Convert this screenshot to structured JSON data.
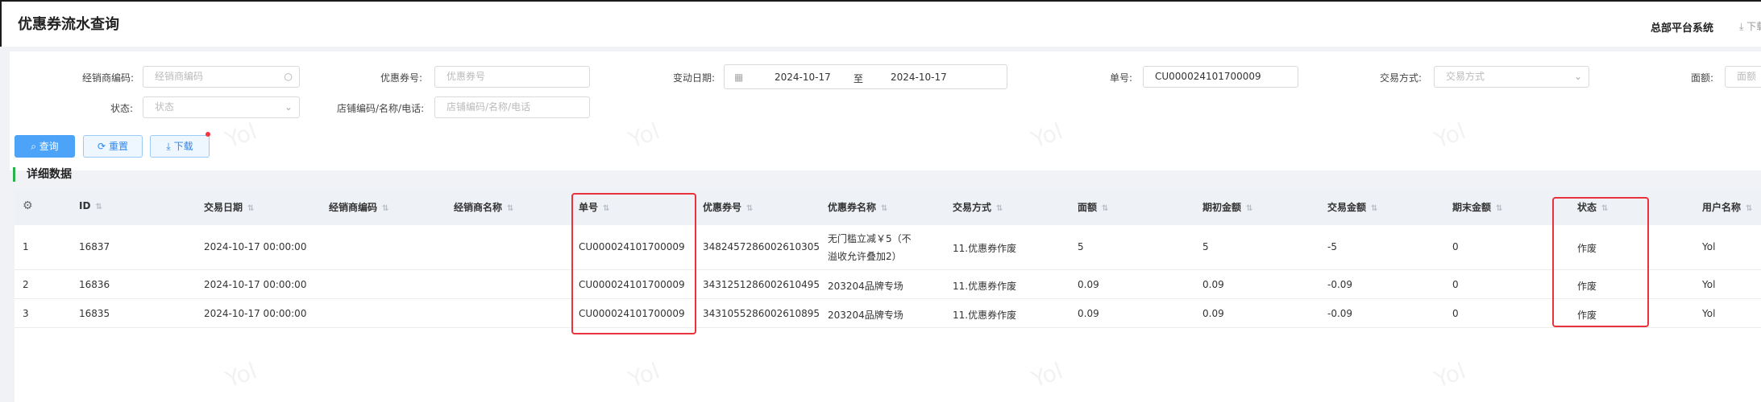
{
  "header": {
    "title": "优惠券流水查询",
    "platform": "总部平台系统",
    "download_top": "⤓ 下载"
  },
  "filters": {
    "dealer_code": {
      "label": "经销商编码:",
      "placeholder": "经销商编码"
    },
    "coupon_no": {
      "label": "优惠券号:",
      "placeholder": "优惠券号"
    },
    "change_date": {
      "label": "变动日期:",
      "start": "2024-10-17",
      "separator": "至",
      "end": "2024-10-17"
    },
    "order_no": {
      "label": "单号:",
      "value": "CU000024101700009"
    },
    "trade_method": {
      "label": "交易方式:",
      "placeholder": "交易方式"
    },
    "face_value": {
      "label": "面额:",
      "placeholder": "面额"
    },
    "status": {
      "label": "状态:",
      "placeholder": "状态"
    },
    "store": {
      "label": "店铺编码/名称/电话:",
      "placeholder": "店铺编码/名称/电话"
    }
  },
  "buttons": {
    "query": "查询",
    "reset": "重置",
    "download": "下载"
  },
  "section_title": "详细数据",
  "table": {
    "columns": [
      "ID",
      "交易日期",
      "经销商编码",
      "经销商名称",
      "单号",
      "优惠券号",
      "优惠券名称",
      "交易方式",
      "面额",
      "期初金额",
      "交易金额",
      "期末金额",
      "状态",
      "用户名称"
    ],
    "rows": [
      {
        "index": "1",
        "id": "16837",
        "date": "2024-10-17 00:00:00",
        "dealer_code": "",
        "dealer_name": "",
        "order_no": "CU000024101700009",
        "coupon_no": "3482457286002610305",
        "coupon_name": "无门槛立减￥5（不溢收允许叠加2）",
        "method": "11.优惠券作废",
        "face": "5",
        "opening": "5",
        "amount": "-5",
        "closing": "0",
        "status": "作废",
        "user": "Yol"
      },
      {
        "index": "2",
        "id": "16836",
        "date": "2024-10-17 00:00:00",
        "dealer_code": "",
        "dealer_name": "",
        "order_no": "CU000024101700009",
        "coupon_no": "3431251286002610495",
        "coupon_name": "203204品牌专场",
        "method": "11.优惠券作废",
        "face": "0.09",
        "opening": "0.09",
        "amount": "-0.09",
        "closing": "0",
        "status": "作废",
        "user": "Yol"
      },
      {
        "index": "3",
        "id": "16835",
        "date": "2024-10-17 00:00:00",
        "dealer_code": "",
        "dealer_name": "",
        "order_no": "CU000024101700009",
        "coupon_no": "3431055286002610895",
        "coupon_name": "203204品牌专场",
        "method": "11.优惠券作废",
        "face": "0.09",
        "opening": "0.09",
        "amount": "-0.09",
        "closing": "0",
        "status": "作废",
        "user": "Yol"
      }
    ]
  },
  "watermark": "Yol",
  "colors": {
    "primary": "#4da3f7",
    "accent_green": "#2bb14c",
    "highlight_red": "#e8323c"
  }
}
